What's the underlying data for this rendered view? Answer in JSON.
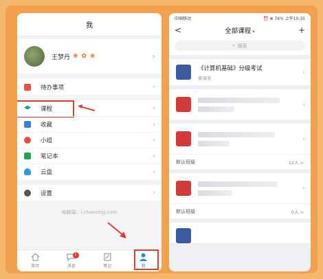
{
  "left": {
    "title": "我",
    "profile": {
      "name": "王梦丹",
      "decoration": "❀ ✿ ❀"
    },
    "menu_group1": [
      {
        "label": "待办事项",
        "icon": "todo-icon",
        "color": "#e8513f"
      }
    ],
    "menu_group2": [
      {
        "label": "课程",
        "icon": "graduation-cap-icon",
        "color": "#19a38a"
      },
      {
        "label": "收藏",
        "icon": "bookmark-icon",
        "color": "#3c7ed8"
      },
      {
        "label": "小组",
        "icon": "group-icon",
        "color": "#e8513f"
      },
      {
        "label": "笔记本",
        "icon": "notebook-icon",
        "color": "#23a35a"
      },
      {
        "label": "云盘",
        "icon": "cloud-icon",
        "color": "#2f9be6"
      }
    ],
    "menu_group3": [
      {
        "label": "设置",
        "icon": "gear-icon",
        "color": "#555555"
      }
    ],
    "site_text": "电脑端：i.chaoxing.com",
    "tabbar": [
      {
        "label": "首页",
        "icon": "home-icon"
      },
      {
        "label": "消息",
        "icon": "message-icon",
        "badge": "1"
      },
      {
        "label": "笔记",
        "icon": "note-icon"
      },
      {
        "label": "我",
        "icon": "user-icon"
      }
    ]
  },
  "right": {
    "status": {
      "carrier": "中国移动",
      "right": "⏰ ✻ 76% 上午10:35"
    },
    "nav": {
      "back": "<",
      "title": "全部课程",
      "add": "+"
    },
    "search_placeholder": "搜索",
    "courses": [
      {
        "title": "《计算机基础》分级考试",
        "teacher": "黄海芳",
        "icon_color": "#3a5ba0"
      },
      {
        "title": "",
        "teacher": "",
        "icon_color": "#d23b3b"
      },
      {
        "title": "",
        "teacher": "",
        "icon_color": "#d23b3b",
        "class_label": "默认班级",
        "count": "12人 >"
      },
      {
        "title": "",
        "teacher": "",
        "icon_color": "#d23b3b",
        "class_label": "默认班级",
        "count": "0人 >"
      }
    ]
  },
  "colors": {
    "accent_red": "#e23c32",
    "frame": "#f2a24f",
    "link_blue": "#3a7bd5"
  }
}
